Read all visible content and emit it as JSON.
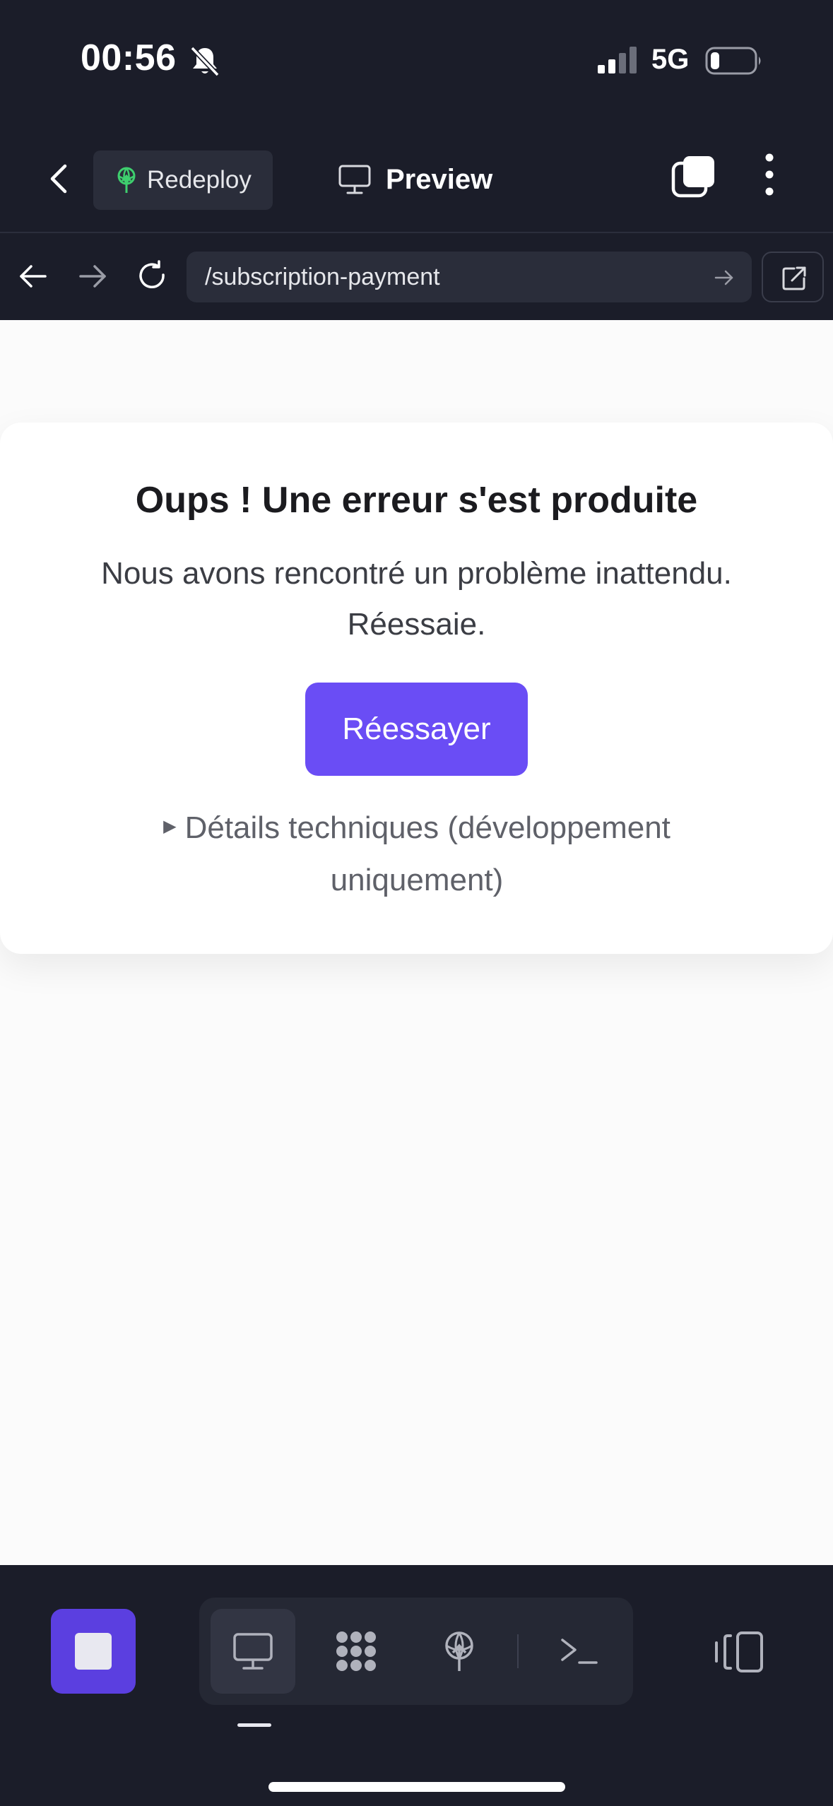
{
  "status_bar": {
    "time": "00:56",
    "network": "5G"
  },
  "header": {
    "redeploy_label": "Redeploy",
    "title": "Preview"
  },
  "url_bar": {
    "url": "/subscription-payment"
  },
  "error_card": {
    "title": "Oups ! Une erreur s'est produite",
    "message": "Nous avons rencontré un problème inattendu. Réessaie.",
    "retry_label": "Réessayer",
    "details_label": "Détails techniques (développement uniquement)"
  },
  "bottom_bar": {
    "tools": [
      "monitor-icon",
      "apps-grid-icon",
      "deploy-icon",
      "terminal-icon"
    ],
    "active_tool": "monitor-icon"
  },
  "colors": {
    "accent": "#6a4df5",
    "stop_button": "#5b3fe0",
    "background_dark": "#1b1d29"
  }
}
